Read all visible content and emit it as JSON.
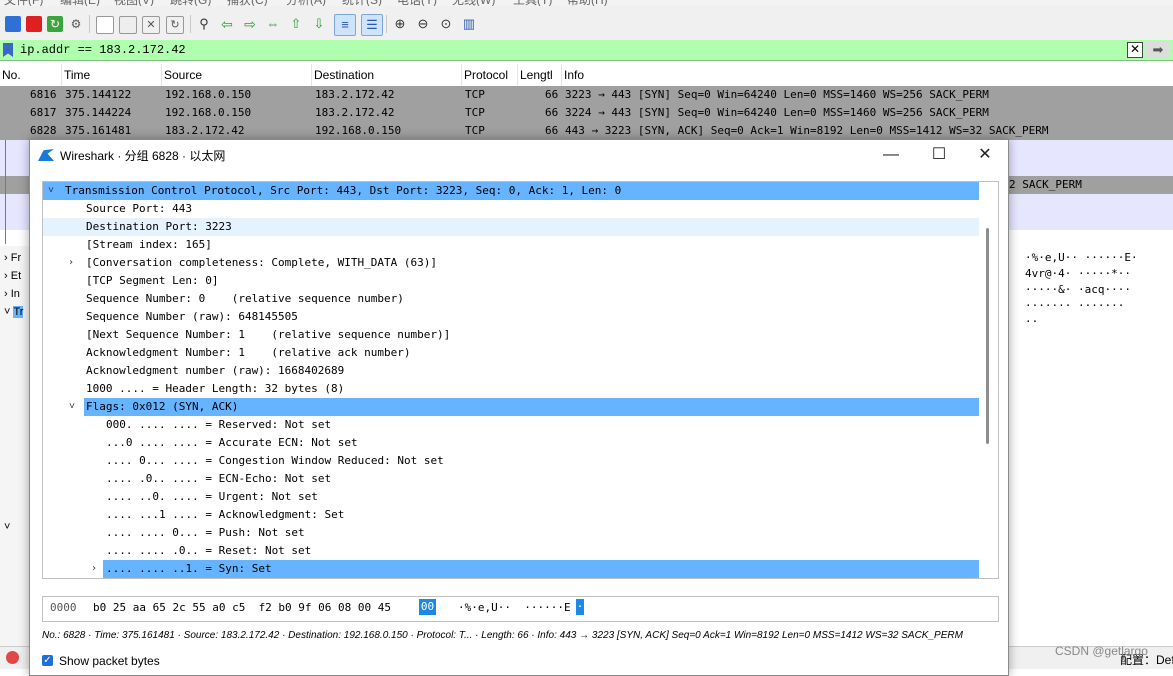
{
  "menubar": {
    "items": [
      "文件(F)",
      "编辑(E)",
      "视图(V)",
      "跳转(G)",
      "捕获(C)",
      "分析(A)",
      "统计(S)",
      "电话(Y)",
      "无线(W)",
      "工具(T)",
      "帮助(H)"
    ]
  },
  "toolbar": {
    "icons": [
      "shark-fin-icon",
      "stop-capture-icon",
      "restart-capture-icon",
      "capture-options-icon",
      "open-file-icon",
      "save-file-icon",
      "close-file-icon",
      "reload-file-icon",
      "find-packet-icon",
      "go-back-icon",
      "go-forward-icon",
      "go-to-packet-icon",
      "go-first-icon",
      "go-last-icon",
      "auto-scroll-icon",
      "colorize-icon",
      "zoom-in-icon",
      "zoom-out-icon",
      "zoom-reset-icon",
      "resize-columns-icon"
    ],
    "accent": "#3a66c6"
  },
  "filter": {
    "value": "ip.addr == 183.2.172.42",
    "clear_glyph": "✕",
    "apply_glyph": "➡",
    "bg_color": "#afffaf"
  },
  "packet_list": {
    "columns": [
      "No.",
      "Time",
      "Source",
      "Destination",
      "Protocol",
      "Lengtl",
      "Info"
    ],
    "rows": [
      {
        "no": "6816",
        "time": "375.144122",
        "src": "192.168.0.150",
        "dst": "183.2.172.42",
        "proto": "TCP",
        "len": "66",
        "info": "3223 → 443 [SYN] Seq=0 Win=64240 Len=0 MSS=1460 WS=256 SACK_PERM"
      },
      {
        "no": "6817",
        "time": "375.144224",
        "src": "192.168.0.150",
        "dst": "183.2.172.42",
        "proto": "TCP",
        "len": "66",
        "info": "3224 → 443 [SYN] Seq=0 Win=64240 Len=0 MSS=1460 WS=256 SACK_PERM"
      },
      {
        "no": "6828",
        "time": "375.161481",
        "src": "183.2.172.42",
        "dst": "192.168.0.150",
        "proto": "TCP",
        "len": "66",
        "info": "443 → 3223 [SYN, ACK] Seq=0 Ack=1 Win=8192 Len=0 MSS=1412 WS=32 SACK_PERM"
      }
    ],
    "partial_info_tail": "2 SACK_PERM",
    "row_color_gray": "#a0a0a0",
    "row_color_lavender": "#e7e6ff"
  },
  "background_details": {
    "items": [
      "Fr",
      "Et",
      "In",
      "Tr"
    ]
  },
  "background_hex": {
    "lines": [
      "·%·e,U··  ······E·",
      "4vr@·4·  ·····*··",
      "·····&·  ·acq····",
      "·······  ·······",
      "··"
    ]
  },
  "dialog": {
    "title": "Wireshark · 分组 6828 · 以太网",
    "controls": {
      "minimize": "—",
      "maximize": "☐",
      "close": "✕"
    },
    "tree": [
      {
        "text": "Transmission Control Protocol, Src Port: 443, Dst Port: 3223, Seq: 0, Ack: 1, Len: 0",
        "arrow": "˅",
        "state": "selected"
      },
      {
        "text": "Source Port: 443",
        "arrow": "",
        "state": ""
      },
      {
        "text": "Destination Port: 3223",
        "arrow": "",
        "state": "hover"
      },
      {
        "text": "[Stream index: 165]",
        "arrow": "",
        "state": ""
      },
      {
        "text": "[Conversation completeness: Complete, WITH_DATA (63)]",
        "arrow": "›",
        "state": ""
      },
      {
        "text": "[TCP Segment Len: 0]",
        "arrow": "",
        "state": ""
      },
      {
        "text": "Sequence Number: 0    (relative sequence number)",
        "arrow": "",
        "state": ""
      },
      {
        "text": "Sequence Number (raw): 648145505",
        "arrow": "",
        "state": ""
      },
      {
        "text": "[Next Sequence Number: 1    (relative sequence number)]",
        "arrow": "",
        "state": ""
      },
      {
        "text": "Acknowledgment Number: 1    (relative ack number)",
        "arrow": "",
        "state": ""
      },
      {
        "text": "Acknowledgment number (raw): 1668402689",
        "arrow": "",
        "state": ""
      },
      {
        "text": "1000 .... = Header Length: 32 bytes (8)",
        "arrow": "",
        "state": ""
      },
      {
        "text": "Flags: 0x012 (SYN, ACK)",
        "arrow": "˅",
        "state": "selected"
      },
      {
        "text": "000. .... .... = Reserved: Not set",
        "arrow": "",
        "state": ""
      },
      {
        "text": "...0 .... .... = Accurate ECN: Not set",
        "arrow": "",
        "state": ""
      },
      {
        "text": ".... 0... .... = Congestion Window Reduced: Not set",
        "arrow": "",
        "state": ""
      },
      {
        "text": ".... .0.. .... = ECN-Echo: Not set",
        "arrow": "",
        "state": ""
      },
      {
        "text": ".... ..0. .... = Urgent: Not set",
        "arrow": "",
        "state": ""
      },
      {
        "text": ".... ...1 .... = Acknowledgment: Set",
        "arrow": "",
        "state": ""
      },
      {
        "text": ".... .... 0... = Push: Not set",
        "arrow": "",
        "state": ""
      },
      {
        "text": ".... .... .0.. = Reset: Not set",
        "arrow": "",
        "state": ""
      },
      {
        "text": ".... .... ..1. = Syn: Set",
        "arrow": "›",
        "state": "selected"
      }
    ],
    "hex": {
      "offset": "0000",
      "bytes": "b0 25 aa 65 2c 55 a0 c5  f2 b0 9f 06 08 00 45",
      "selected_byte": "00",
      "ascii": "·%·e,U··  ······E",
      "ascii_selected": "·"
    },
    "summary": "No.: 6828 · Time: 375.161481 · Source: 183.2.172.42 · Destination: 192.168.0.150 · Protocol: T... · Length: 66 · Info: 443 → 3223 [SYN, ACK] Seq=0 Ack=1 Win=8192 Len=0 MSS=1412 WS=32 SACK_PERM",
    "show_bytes_label": "Show packet bytes",
    "show_bytes_checked": true,
    "selection_color": "#66b3ff"
  },
  "statusbar": {
    "profile_label": "配置：Def"
  },
  "watermark": "CSDN @getlargo"
}
